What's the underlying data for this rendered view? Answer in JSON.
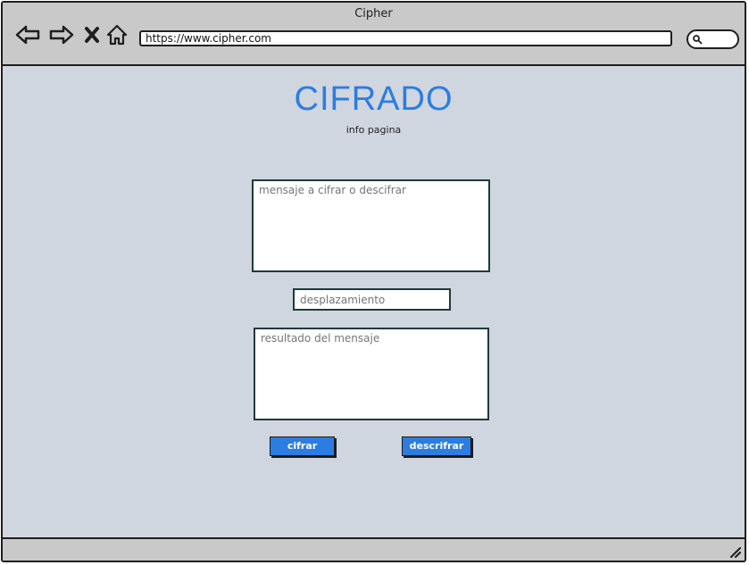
{
  "window": {
    "title": "Cipher",
    "url": "https://www.cipher.com"
  },
  "toolbar": {
    "icons": [
      "back-arrow-icon",
      "forward-arrow-icon",
      "close-icon",
      "home-icon"
    ]
  },
  "search": {
    "icon": "search-icon"
  },
  "page": {
    "title": "CIFRADO",
    "subtitle": "info pagina",
    "message_placeholder": "mensaje a cifrar o descifrar",
    "shift_placeholder": "desplazamiento",
    "result_placeholder": "resultado del mensaje",
    "encrypt_label": "cifrar",
    "decrypt_label": "descrifrar"
  },
  "colors": {
    "accent": "#2b7de1",
    "content_bg": "#d0d6df",
    "chrome_bg": "#c9c9c9"
  }
}
